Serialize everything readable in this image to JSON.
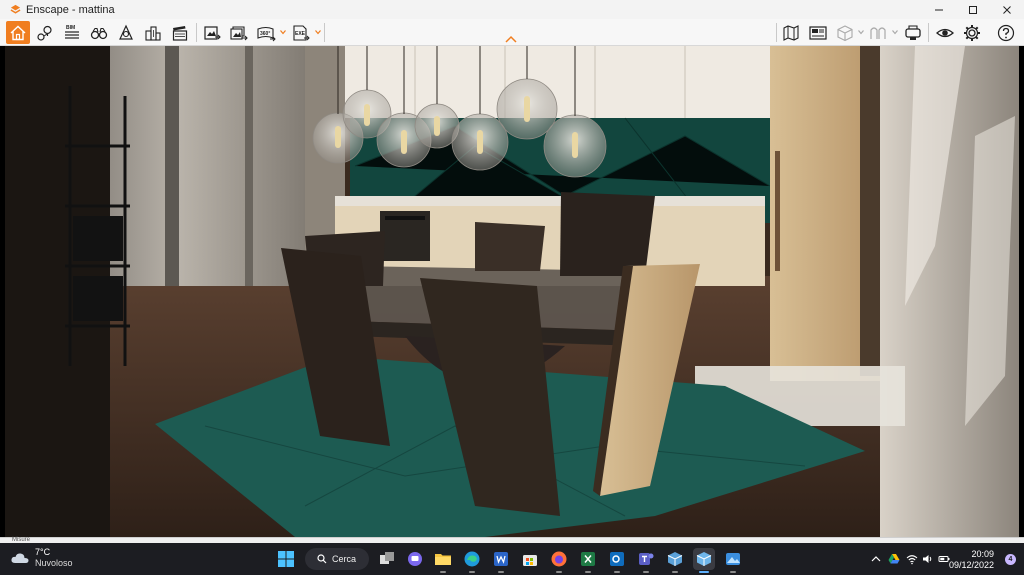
{
  "window": {
    "title": "Enscape - mattina",
    "controls": [
      "minimize",
      "maximize",
      "close"
    ]
  },
  "toolbar": {
    "left_tools": [
      {
        "name": "home-icon",
        "active": true
      },
      {
        "name": "navigation-pin-icon"
      },
      {
        "name": "bim-icon",
        "label": "BIM"
      },
      {
        "name": "binoculars-icon"
      },
      {
        "name": "compass-icon"
      },
      {
        "name": "buildings-icon"
      },
      {
        "name": "clapperboard-icon"
      }
    ],
    "export_tools": [
      {
        "name": "screenshot-export-icon"
      },
      {
        "name": "batch-export-icon"
      },
      {
        "name": "panorama-export-icon",
        "label": "360°"
      },
      {
        "name": "exe-export-icon",
        "label": "EXE"
      }
    ],
    "right_tools": [
      {
        "name": "map-icon"
      },
      {
        "name": "views-icon"
      },
      {
        "name": "cube-icon"
      },
      {
        "name": "material-icon"
      },
      {
        "name": "vr-headset-icon"
      },
      {
        "name": "eye-icon"
      },
      {
        "name": "settings-gear-icon"
      },
      {
        "name": "help-icon"
      }
    ],
    "accent_color": "#f07e20"
  },
  "statusbar": {
    "label": "Misure"
  },
  "taskbar": {
    "weather": {
      "temperature": "7°C",
      "condition": "Nuvoloso"
    },
    "search_label": "Cerca",
    "apps": [
      "windows-start-icon",
      "task-view-icon",
      "teams-chat-icon",
      "file-explorer-icon",
      "edge-browser-icon",
      "word-icon",
      "store-icon",
      "firefox-icon",
      "excel-icon",
      "outlook-icon",
      "teams-icon",
      "enscape-app-icon",
      "enscape-active-icon",
      "photos-icon"
    ],
    "clock": {
      "time": "20:09",
      "date": "09/12/2022"
    },
    "notifications": "4"
  }
}
